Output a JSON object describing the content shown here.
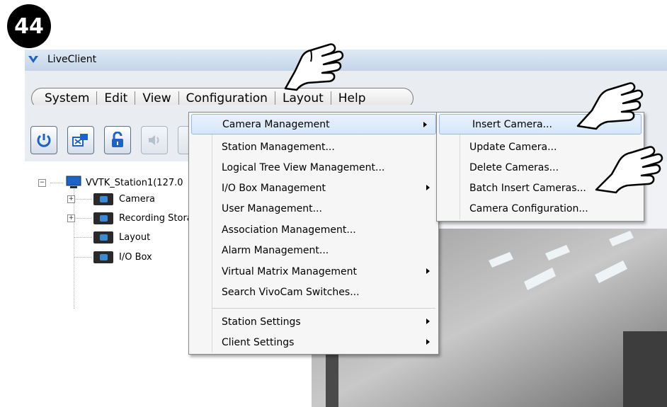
{
  "step": "44",
  "window": {
    "title": "LiveClient"
  },
  "menubar": [
    "System",
    "Edit",
    "View",
    "Configuration",
    "Layout",
    "Help"
  ],
  "tree": {
    "root": "VVTK_Station1(127.0",
    "children": [
      "Camera",
      "Recording Stora",
      "Layout",
      "I/O Box"
    ]
  },
  "config_menu": {
    "items": [
      {
        "label": "Camera Management",
        "submenu": true
      },
      {
        "label": "Station Management...",
        "submenu": false
      },
      {
        "label": "Logical Tree View Management...",
        "submenu": false
      },
      {
        "label": "I/O Box Management",
        "submenu": true
      },
      {
        "label": "User Management...",
        "submenu": false
      },
      {
        "label": "Association Management...",
        "submenu": false
      },
      {
        "label": "Alarm Management...",
        "submenu": false
      },
      {
        "label": "Virtual Matrix Management",
        "submenu": true
      },
      {
        "label": "Search VivoCam Switches...",
        "submenu": false
      },
      {
        "label": "Station Settings",
        "submenu": true
      },
      {
        "label": "Client Settings",
        "submenu": true
      }
    ]
  },
  "camera_submenu": {
    "items": [
      "Insert Camera...",
      "Update Camera...",
      "Delete Cameras...",
      "Batch Insert Cameras...",
      "Camera Configuration..."
    ]
  },
  "toolbar_icons": [
    "power-icon",
    "remote-desktop-icon",
    "lock-icon",
    "speaker-icon"
  ],
  "colors": {
    "highlight": "#d6e6f8",
    "accent_blue": "#1b63c6"
  }
}
